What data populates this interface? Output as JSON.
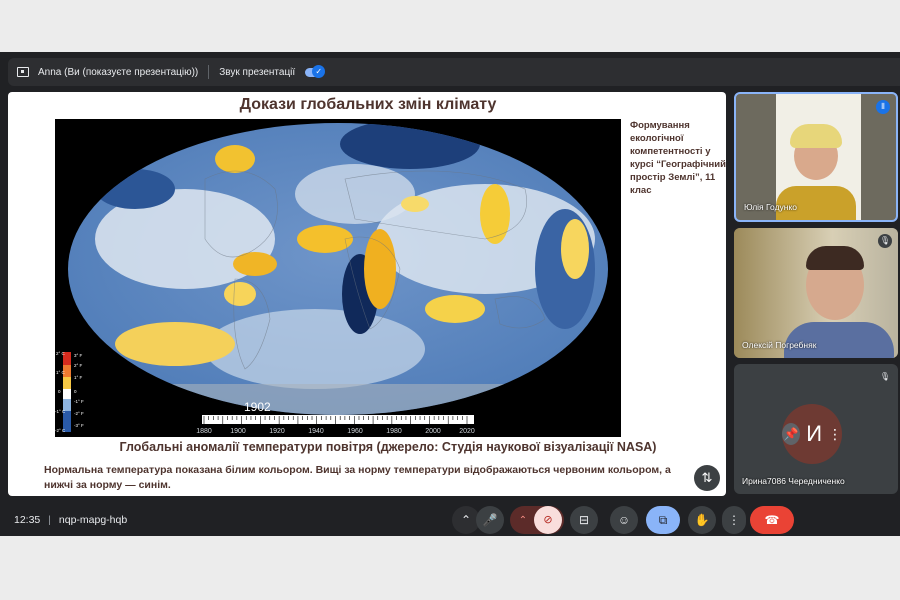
{
  "topbar": {
    "presenter": "Anna (Ви (показуєте презентацію))",
    "sound_label": "Звук презентації",
    "sound_on": true
  },
  "slide": {
    "title": "Докази глобальних змін клімату",
    "side_note": "Формування екологічної компетентності у курсі “Географічний простір Землі”, 11 клас",
    "caption": "Глобальні аномалії температури повітря (джерело: Студія наукової візуалізації NASA)",
    "description": "Нормальна температура показана білим кольором. Вищі за норму температури відображаються червоним кольором, а нижчі за норму — синім.",
    "map": {
      "year": "1902",
      "timeline_ticks": [
        "1880",
        "1900",
        "1920",
        "1940",
        "1960",
        "1980",
        "2000",
        "2020"
      ],
      "legend_c": [
        "2° C",
        "1° C",
        "0",
        "-1° C",
        "-2° C"
      ],
      "legend_f": [
        "3° F",
        "2° F",
        "1° F",
        "0",
        "-1° F",
        "-2° F",
        "-3° F"
      ]
    }
  },
  "participants": [
    {
      "name": "Юлія Годунко",
      "speaking": true
    },
    {
      "name": "Олексій Погребняк",
      "muted": true
    },
    {
      "name": "Ирина7086 Чередниченко",
      "muted": true,
      "initial": "И"
    }
  ],
  "bottombar": {
    "time": "12:35",
    "meeting_code": "nqp-mapg-hqb"
  },
  "colors": {
    "background": "#202124",
    "accent": "#8ab4f8",
    "end_call": "#ea4335",
    "cam_off": "#f9dedc"
  }
}
